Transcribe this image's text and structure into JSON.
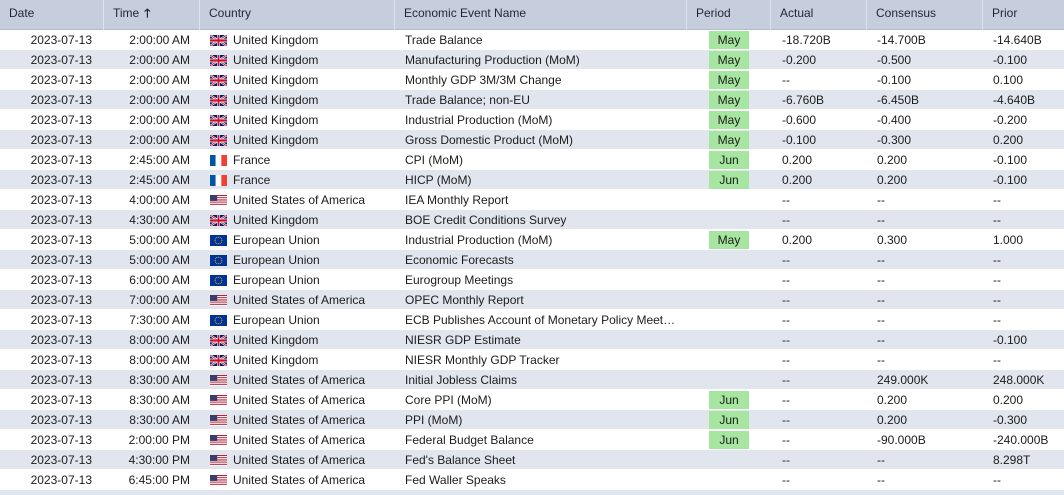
{
  "columns": [
    {
      "key": "date",
      "label": "Date"
    },
    {
      "key": "time",
      "label": "Time",
      "sort_icon": "arrow-up-icon",
      "sort_glyph": "🡑"
    },
    {
      "key": "country",
      "label": "Country"
    },
    {
      "key": "event",
      "label": "Economic Event Name"
    },
    {
      "key": "period",
      "label": "Period"
    },
    {
      "key": "actual",
      "label": "Actual"
    },
    {
      "key": "consensus",
      "label": "Consensus"
    },
    {
      "key": "prior",
      "label": "Prior"
    }
  ],
  "colors": {
    "header_bg": "#c6cedd",
    "row_alt_bg": "#e1e5ee",
    "period_badge_bg": "#a6e6a0"
  },
  "rows": [
    {
      "date": "2023-07-13",
      "time": "2:00:00 AM",
      "flag": "uk-flag-icon",
      "country": "United Kingdom",
      "event": "Trade Balance",
      "period": "May",
      "actual": "-18.720B",
      "consensus": "-14.700B",
      "prior": "-14.640B"
    },
    {
      "date": "2023-07-13",
      "time": "2:00:00 AM",
      "flag": "uk-flag-icon",
      "country": "United Kingdom",
      "event": "Manufacturing Production (MoM)",
      "period": "May",
      "actual": "-0.200",
      "consensus": "-0.500",
      "prior": "-0.100"
    },
    {
      "date": "2023-07-13",
      "time": "2:00:00 AM",
      "flag": "uk-flag-icon",
      "country": "United Kingdom",
      "event": "Monthly GDP 3M/3M Change",
      "period": "May",
      "actual": "--",
      "consensus": "-0.100",
      "prior": "0.100"
    },
    {
      "date": "2023-07-13",
      "time": "2:00:00 AM",
      "flag": "uk-flag-icon",
      "country": "United Kingdom",
      "event": "Trade Balance; non-EU",
      "period": "May",
      "actual": "-6.760B",
      "consensus": "-6.450B",
      "prior": "-4.640B"
    },
    {
      "date": "2023-07-13",
      "time": "2:00:00 AM",
      "flag": "uk-flag-icon",
      "country": "United Kingdom",
      "event": "Industrial Production (MoM)",
      "period": "May",
      "actual": "-0.600",
      "consensus": "-0.400",
      "prior": "-0.200"
    },
    {
      "date": "2023-07-13",
      "time": "2:00:00 AM",
      "flag": "uk-flag-icon",
      "country": "United Kingdom",
      "event": "Gross Domestic Product (MoM)",
      "period": "May",
      "actual": "-0.100",
      "consensus": "-0.300",
      "prior": "0.200"
    },
    {
      "date": "2023-07-13",
      "time": "2:45:00 AM",
      "flag": "france-flag-icon",
      "country": "France",
      "event": "CPI (MoM)",
      "period": "Jun",
      "actual": "0.200",
      "consensus": "0.200",
      "prior": "-0.100"
    },
    {
      "date": "2023-07-13",
      "time": "2:45:00 AM",
      "flag": "france-flag-icon",
      "country": "France",
      "event": "HICP (MoM)",
      "period": "Jun",
      "actual": "0.200",
      "consensus": "0.200",
      "prior": "-0.100"
    },
    {
      "date": "2023-07-13",
      "time": "4:00:00 AM",
      "flag": "usa-flag-icon",
      "country": "United States of America",
      "event": "IEA Monthly Report",
      "period": "",
      "actual": "--",
      "consensus": "--",
      "prior": "--"
    },
    {
      "date": "2023-07-13",
      "time": "4:30:00 AM",
      "flag": "uk-flag-icon",
      "country": "United Kingdom",
      "event": "BOE Credit Conditions Survey",
      "period": "",
      "actual": "--",
      "consensus": "--",
      "prior": "--"
    },
    {
      "date": "2023-07-13",
      "time": "5:00:00 AM",
      "flag": "eu-flag-icon",
      "country": "European Union",
      "event": "Industrial Production (MoM)",
      "period": "May",
      "actual": "0.200",
      "consensus": "0.300",
      "prior": "1.000"
    },
    {
      "date": "2023-07-13",
      "time": "5:00:00 AM",
      "flag": "eu-flag-icon",
      "country": "European Union",
      "event": "Economic Forecasts",
      "period": "",
      "actual": "--",
      "consensus": "--",
      "prior": "--"
    },
    {
      "date": "2023-07-13",
      "time": "6:00:00 AM",
      "flag": "eu-flag-icon",
      "country": "European Union",
      "event": "Eurogroup Meetings",
      "period": "",
      "actual": "--",
      "consensus": "--",
      "prior": "--"
    },
    {
      "date": "2023-07-13",
      "time": "7:00:00 AM",
      "flag": "usa-flag-icon",
      "country": "United States of America",
      "event": "OPEC Monthly Report",
      "period": "",
      "actual": "--",
      "consensus": "--",
      "prior": "--"
    },
    {
      "date": "2023-07-13",
      "time": "7:30:00 AM",
      "flag": "eu-flag-icon",
      "country": "European Union",
      "event": "ECB Publishes Account of Monetary Policy Meet…",
      "period": "",
      "actual": "--",
      "consensus": "--",
      "prior": "--"
    },
    {
      "date": "2023-07-13",
      "time": "8:00:00 AM",
      "flag": "uk-flag-icon",
      "country": "United Kingdom",
      "event": "NIESR GDP Estimate",
      "period": "",
      "actual": "--",
      "consensus": "--",
      "prior": "-0.100"
    },
    {
      "date": "2023-07-13",
      "time": "8:00:00 AM",
      "flag": "uk-flag-icon",
      "country": "United Kingdom",
      "event": "NIESR Monthly GDP Tracker",
      "period": "",
      "actual": "--",
      "consensus": "--",
      "prior": "--"
    },
    {
      "date": "2023-07-13",
      "time": "8:30:00 AM",
      "flag": "usa-flag-icon",
      "country": "United States of America",
      "event": "Initial Jobless Claims",
      "period": "",
      "actual": "--",
      "consensus": "249.000K",
      "prior": "248.000K"
    },
    {
      "date": "2023-07-13",
      "time": "8:30:00 AM",
      "flag": "usa-flag-icon",
      "country": "United States of America",
      "event": "Core PPI (MoM)",
      "period": "Jun",
      "actual": "--",
      "consensus": "0.200",
      "prior": "0.200"
    },
    {
      "date": "2023-07-13",
      "time": "8:30:00 AM",
      "flag": "usa-flag-icon",
      "country": "United States of America",
      "event": "PPI (MoM)",
      "period": "Jun",
      "actual": "--",
      "consensus": "0.200",
      "prior": "-0.300"
    },
    {
      "date": "2023-07-13",
      "time": "2:00:00 PM",
      "flag": "usa-flag-icon",
      "country": "United States of America",
      "event": "Federal Budget Balance",
      "period": "Jun",
      "actual": "--",
      "consensus": "-90.000B",
      "prior": "-240.000B"
    },
    {
      "date": "2023-07-13",
      "time": "4:30:00 PM",
      "flag": "usa-flag-icon",
      "country": "United States of America",
      "event": "Fed's Balance Sheet",
      "period": "",
      "actual": "--",
      "consensus": "--",
      "prior": "8.298T"
    },
    {
      "date": "2023-07-13",
      "time": "6:45:00 PM",
      "flag": "usa-flag-icon",
      "country": "United States of America",
      "event": "Fed Waller Speaks",
      "period": "",
      "actual": "--",
      "consensus": "--",
      "prior": "--"
    },
    {
      "date": "",
      "time": "",
      "flag": "usa-flag-icon",
      "country": "",
      "event": "",
      "period": "",
      "actual": "",
      "consensus": "",
      "prior": ""
    }
  ]
}
